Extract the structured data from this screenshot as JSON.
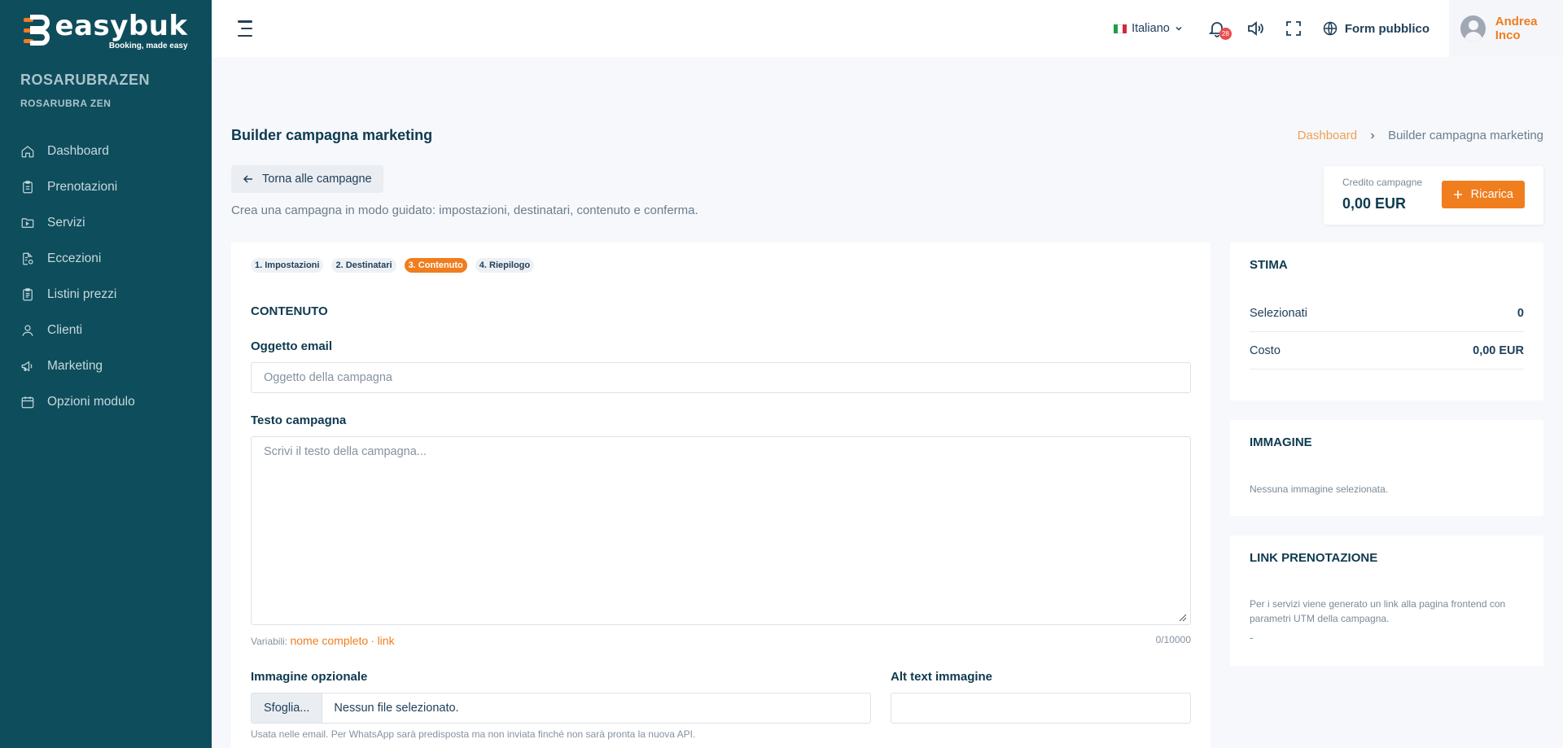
{
  "brand": {
    "name": "easybuk",
    "tagline": "Booking, made easy",
    "accent": "#f07d1e",
    "sidebar_bg": "#0e4d5c"
  },
  "company": {
    "name": "ROSARUBRAZEN",
    "sub": "ROSARUBRA ZEN"
  },
  "nav": [
    {
      "label": "Dashboard",
      "icon": "home-icon"
    },
    {
      "label": "Prenotazioni",
      "icon": "clipboard-icon"
    },
    {
      "label": "Servizi",
      "icon": "folder-icon"
    },
    {
      "label": "Eccezioni",
      "icon": "document-gear-icon"
    },
    {
      "label": "Listini prezzi",
      "icon": "clipboard-list-icon"
    },
    {
      "label": "Clienti",
      "icon": "user-icon"
    },
    {
      "label": "Marketing",
      "icon": "megaphone-icon"
    },
    {
      "label": "Opzioni modulo",
      "icon": "calendar-icon"
    }
  ],
  "topbar": {
    "language": "Italiano",
    "notifications_count": "28",
    "public_form": "Form pubblico",
    "user": "Andrea Inco"
  },
  "page": {
    "title": "Builder campagna marketing",
    "breadcrumb": {
      "home": "Dashboard",
      "current": "Builder campagna marketing"
    },
    "back_label": "Torna alle campagne",
    "subtitle": "Crea una campagna in modo guidato: impostazioni, destinatari, contenuto e conferma."
  },
  "credit": {
    "label": "Credito campagne",
    "value": "0,00 EUR",
    "recharge": "Ricarica"
  },
  "steps": [
    {
      "label": "1. Impostazioni",
      "active": false
    },
    {
      "label": "2. Destinatari",
      "active": false
    },
    {
      "label": "3. Contenuto",
      "active": true
    },
    {
      "label": "4. Riepilogo",
      "active": false
    }
  ],
  "content": {
    "section": "CONTENUTO",
    "subject_label": "Oggetto email",
    "subject_placeholder": "Oggetto della campagna",
    "text_label": "Testo campagna",
    "text_placeholder": "Scrivi il testo della campagna...",
    "vars_prefix": "Variabili:",
    "var_fullname": "nome completo",
    "var_sep": "·",
    "var_link": "link",
    "counter": "0/10000",
    "image_label": "Immagine opzionale",
    "browse": "Sfoglia...",
    "no_file": "Nessun file selezionato.",
    "alt_label": "Alt text immagine",
    "image_help": "Usata nelle email. Per WhatsApp sarà predisposta ma non inviata finché non sarà pronta la nuova API."
  },
  "estimate": {
    "title": "STIMA",
    "selected_label": "Selezionati",
    "selected_value": "0",
    "cost_label": "Costo",
    "cost_value": "0,00 EUR"
  },
  "image_card": {
    "title": "IMMAGINE",
    "text": "Nessuna immagine selezionata."
  },
  "link_card": {
    "title": "LINK PRENOTAZIONE",
    "text": "Per i servizi viene generato un link alla pagina frontend con parametri UTM della campagna.",
    "value": "-"
  }
}
